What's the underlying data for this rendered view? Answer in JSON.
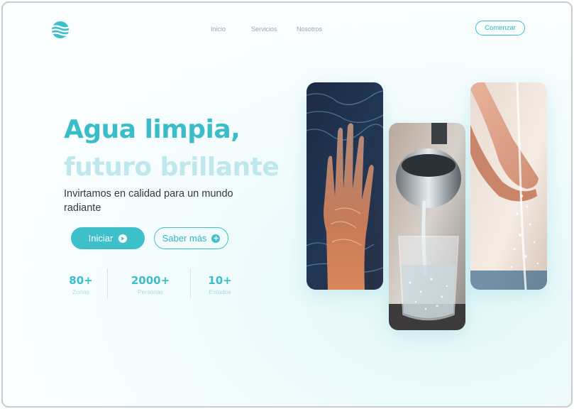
{
  "nav": {
    "links": [
      "Inicio",
      "Servicios",
      "Nosotros"
    ],
    "cta": "Comenzar"
  },
  "hero": {
    "title_line1": "Agua limpia,",
    "title_line2": "futuro brillante",
    "subtitle": "Invirtamos en calidad para un mundo radiante",
    "primary_button": "Iniciar",
    "secondary_button": "Saber más"
  },
  "stats": [
    {
      "value": "80+",
      "label": "Zonas"
    },
    {
      "value": "2000+",
      "label": "Personas"
    },
    {
      "value": "10+",
      "label": "Estados"
    }
  ],
  "colors": {
    "accent": "#3ec0cb",
    "accent_light": "#bfe8ec",
    "text_dark": "#2f3b40"
  },
  "images": [
    "hand-in-water-photo",
    "water-pouring-glass-photo",
    "hands-under-water-stream-photo"
  ]
}
